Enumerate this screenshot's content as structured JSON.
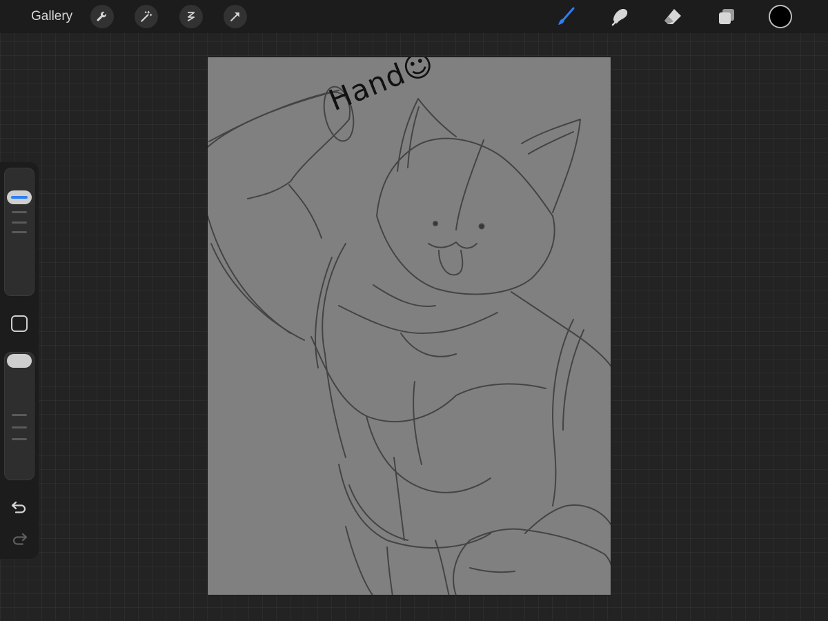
{
  "topbar": {
    "gallery_label": "Gallery",
    "left_tools": [
      {
        "name": "actions",
        "icon": "wrench-icon"
      },
      {
        "name": "adjustments",
        "icon": "magic-wand-icon"
      },
      {
        "name": "selection",
        "icon": "selection-s-icon"
      },
      {
        "name": "transform",
        "icon": "arrow-cursor-icon"
      }
    ],
    "right_tools": [
      {
        "name": "brush",
        "icon": "brush-icon",
        "active": true
      },
      {
        "name": "smudge",
        "icon": "smudge-icon"
      },
      {
        "name": "eraser",
        "icon": "eraser-icon"
      },
      {
        "name": "layers",
        "icon": "layers-icon"
      }
    ],
    "current_color": "#000000",
    "active_color": "#2f7ff0"
  },
  "sidebar": {
    "controls": [
      "size-slider",
      "modify-button",
      "opacity-slider",
      "undo",
      "redo"
    ]
  },
  "canvas": {
    "background": "#808080",
    "annotation_text": "Hand",
    "annotation_suffix": "☺"
  }
}
